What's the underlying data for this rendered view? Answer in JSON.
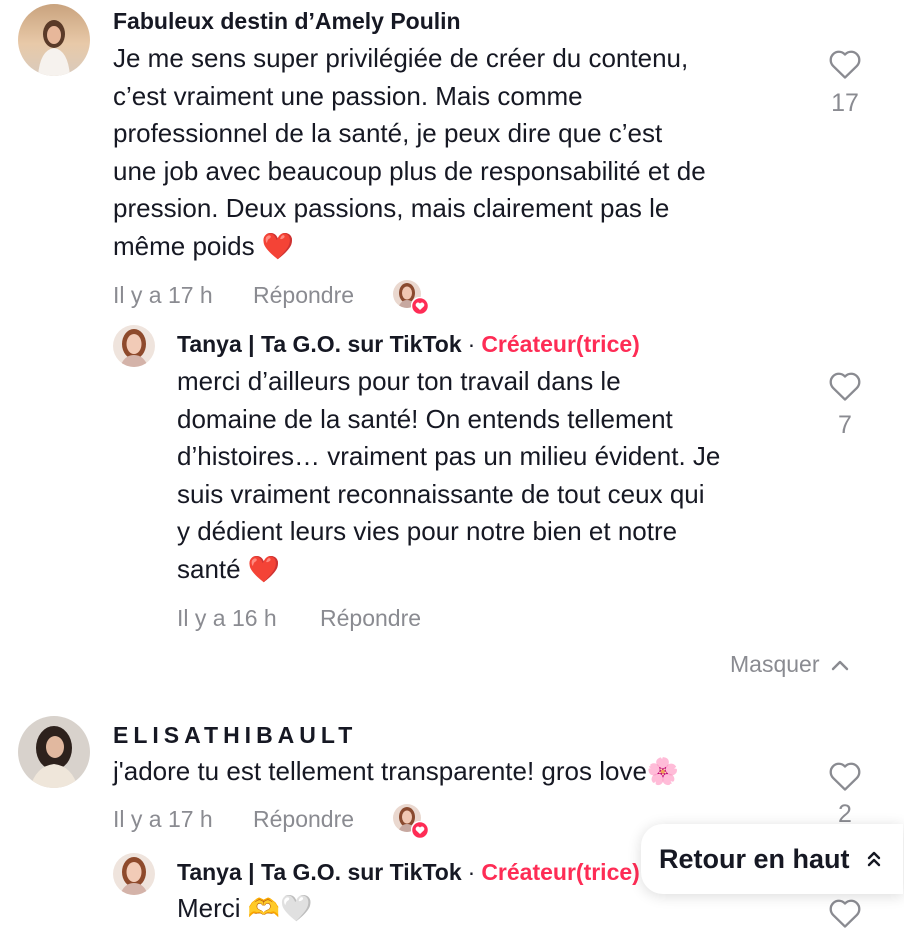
{
  "comments": [
    {
      "username": "Fabuleux destin d’Amely Poulin",
      "lines": [
        "Je me sens super privilégiée de créer du contenu,",
        "c’est vraiment une passion. Mais comme",
        "professionnel de la santé, je peux dire que c’est",
        "une job avec beaucoup plus de responsabilité et de",
        "pression. Deux passions, mais clairement pas le",
        "même poids ❤️"
      ],
      "time": "Il y a 17 h",
      "reply_label": "Répondre",
      "likes": "17",
      "reply": {
        "username": "Tanya | Ta G.O. sur TikTok",
        "separator": "·",
        "badge": "Créateur(trice)",
        "lines": [
          "merci d’ailleurs pour ton travail dans le",
          "domaine de la santé! On entends tellement",
          "d’histoires… vraiment pas un milieu évident. Je",
          "suis vraiment reconnaissante de tout ceux qui",
          "y dédient leurs vies pour notre bien et notre",
          "santé ❤️"
        ],
        "time": "Il y a 16 h",
        "reply_label": "Répondre",
        "likes": "7"
      },
      "hide_label": "Masquer"
    },
    {
      "username": "ELISATHIBAULT",
      "text": "j'adore tu est tellement transparente! gros love🌸",
      "time": "Il y a 17 h",
      "reply_label": "Répondre",
      "likes": "2",
      "reply": {
        "username": "Tanya | Ta G.O. sur TikTok",
        "separator": "·",
        "badge": "Créateur(trice)",
        "text": "Merci 🫶🤍"
      }
    }
  ],
  "back_to_top": {
    "label": "Retour en haut"
  },
  "colors": {
    "creator_badge": "#fe2c55",
    "meta_text": "#8a8b91",
    "like_badge": "#fe2c55"
  },
  "icons": [
    "heart-outline-icon",
    "creator-liked-badge-icon",
    "double-chevron-up-icon",
    "chevron-up-icon"
  ]
}
